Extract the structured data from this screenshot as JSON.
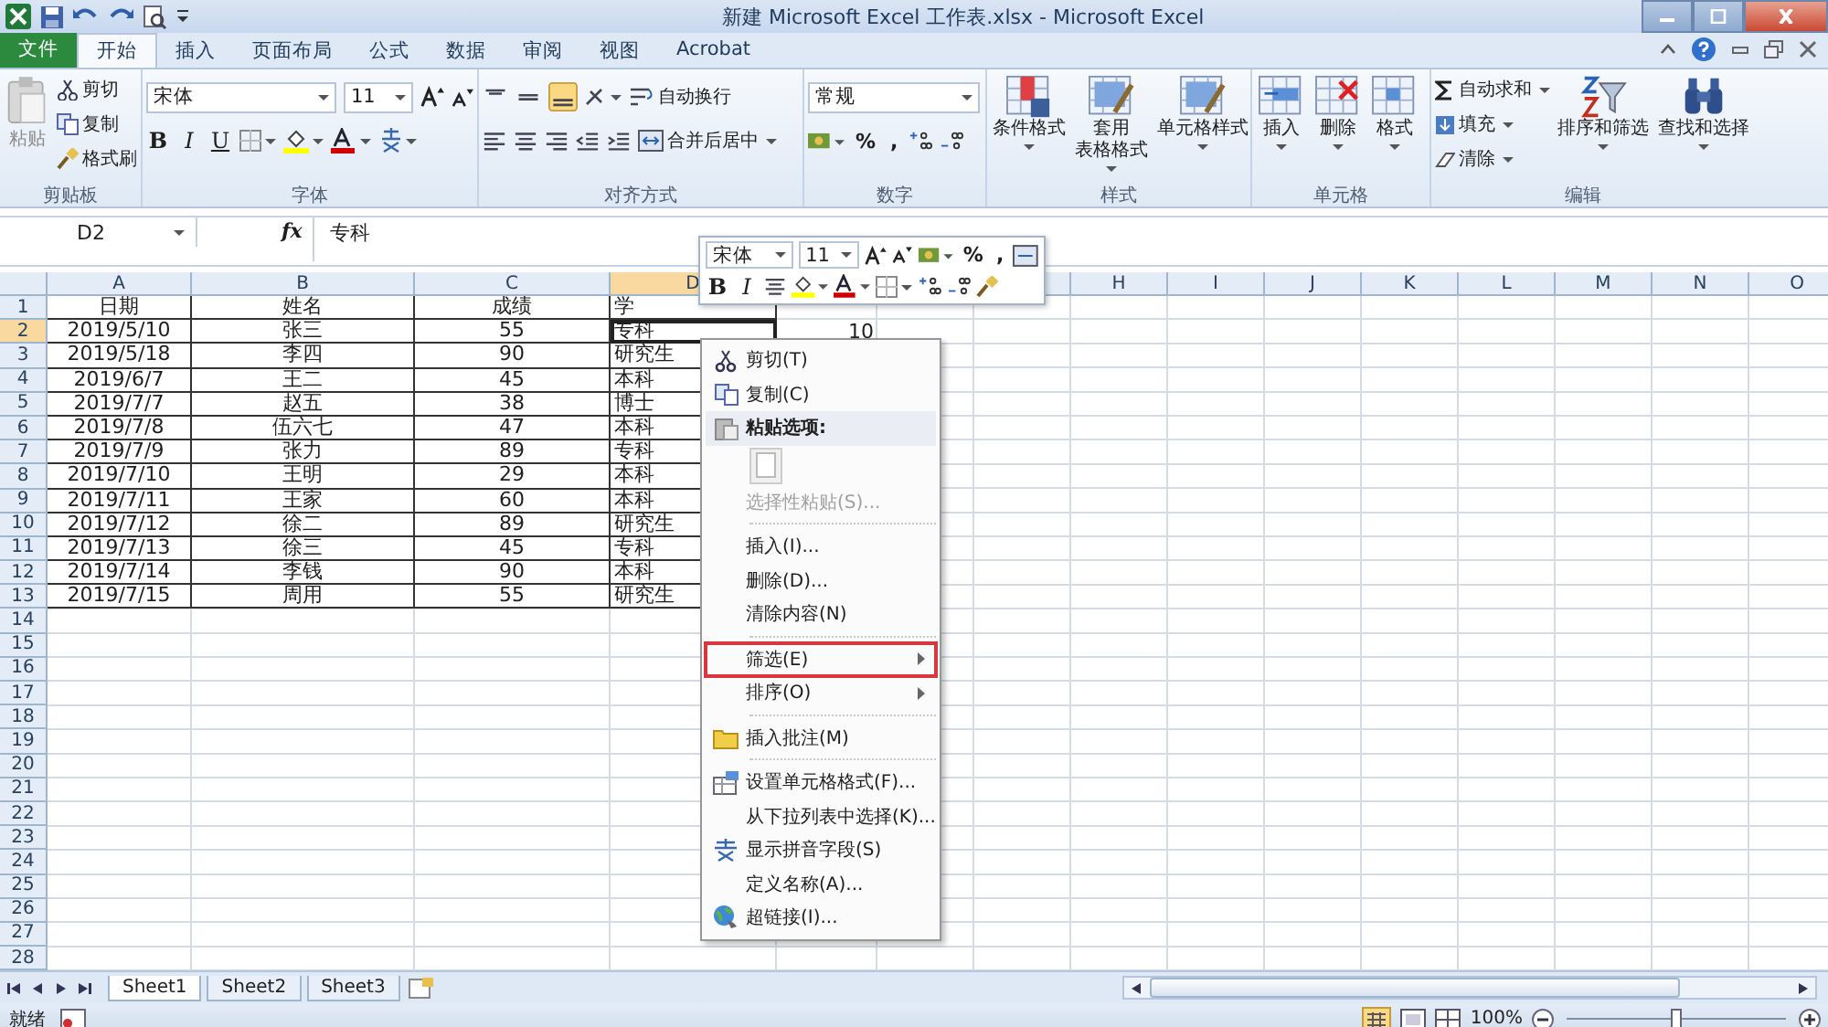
{
  "window": {
    "title": "新建 Microsoft Excel 工作表.xlsx - Microsoft Excel"
  },
  "tabs": [
    {
      "label": "文件",
      "kind": "file"
    },
    {
      "label": "开始",
      "kind": "tab",
      "selected": true
    },
    {
      "label": "插入",
      "kind": "tab",
      "selected": false
    },
    {
      "label": "页面布局",
      "kind": "tab",
      "selected": false
    },
    {
      "label": "公式",
      "kind": "tab",
      "selected": false
    },
    {
      "label": "数据",
      "kind": "tab",
      "selected": false
    },
    {
      "label": "审阅",
      "kind": "tab",
      "selected": false
    },
    {
      "label": "视图",
      "kind": "tab",
      "selected": false
    },
    {
      "label": "Acrobat",
      "kind": "tab",
      "selected": false
    }
  ],
  "ribbon": {
    "clipboard": {
      "label": "剪贴板",
      "paste": "粘贴",
      "items": [
        "剪切",
        "复制",
        "格式刷"
      ]
    },
    "font": {
      "label": "字体",
      "font": "宋体",
      "size": "11",
      "styles": [
        "B",
        "I",
        "U"
      ]
    },
    "alignment": {
      "label": "对齐方式",
      "wrap": "自动换行",
      "merge": "合并后居中"
    },
    "number": {
      "label": "数字",
      "format": "常规",
      "symbols": [
        "%",
        ","
      ]
    },
    "styles": {
      "label": "样式",
      "buttons": [
        {
          "lines": [
            "条件格式"
          ]
        },
        {
          "lines": [
            "套用",
            "表格格式"
          ]
        },
        {
          "lines": [
            "单元格样式"
          ]
        }
      ]
    },
    "cells": {
      "label": "单元格",
      "buttons": [
        {
          "lines": [
            "插入"
          ]
        },
        {
          "lines": [
            "删除"
          ]
        },
        {
          "lines": [
            "格式"
          ]
        }
      ]
    },
    "editing": {
      "label": "编辑",
      "items": [
        "自动求和",
        "填充",
        "清除"
      ],
      "buttons": [
        {
          "lines": [
            "排序和筛选"
          ]
        },
        {
          "lines": [
            "查找和选择"
          ]
        }
      ]
    }
  },
  "formula_bar": {
    "name_box": "D2",
    "fx": "fx",
    "value": "专科"
  },
  "columns": [
    {
      "label": "A",
      "selected": false
    },
    {
      "label": "B",
      "selected": false
    },
    {
      "label": "C",
      "selected": false
    },
    {
      "label": "D",
      "selected": true
    },
    {
      "selected": false
    },
    {
      "label": "H",
      "selected": false
    },
    {
      "label": "I",
      "selected": false
    },
    {
      "label": "J",
      "selected": false
    },
    {
      "label": "K",
      "selected": false
    },
    {
      "label": "L",
      "selected": false
    },
    {
      "label": "M",
      "selected": false
    },
    {
      "label": "N",
      "selected": false
    },
    {
      "label": "O",
      "selected": false
    }
  ],
  "rows": [
    {
      "number": "1",
      "selected": false,
      "cells": [
        "日期",
        "姓名",
        "成绩",
        "学"
      ]
    },
    {
      "number": "2",
      "selected": true,
      "cells": [
        "2019/5/10",
        "张三",
        "55",
        "专科",
        "10"
      ]
    },
    {
      "number": "3",
      "selected": false,
      "cells": [
        "2019/5/18",
        "李四",
        "90",
        "研究生"
      ]
    },
    {
      "number": "4",
      "selected": false,
      "cells": [
        "2019/6/7",
        "王二",
        "45",
        "本科"
      ]
    },
    {
      "number": "5",
      "selected": false,
      "cells": [
        "2019/7/7",
        "赵五",
        "38",
        "博士"
      ]
    },
    {
      "number": "6",
      "selected": false,
      "cells": [
        "2019/7/8",
        "伍六七",
        "47",
        "本科"
      ]
    },
    {
      "number": "7",
      "selected": false,
      "cells": [
        "2019/7/9",
        "张力",
        "89",
        "专科"
      ]
    },
    {
      "number": "8",
      "selected": false,
      "cells": [
        "2019/7/10",
        "王明",
        "29",
        "本科"
      ]
    },
    {
      "number": "9",
      "selected": false,
      "cells": [
        "2019/7/11",
        "王家",
        "60",
        "本科"
      ]
    },
    {
      "number": "10",
      "selected": false,
      "cells": [
        "2019/7/12",
        "徐二",
        "89",
        "研究生"
      ]
    },
    {
      "number": "11",
      "selected": false,
      "cells": [
        "2019/7/13",
        "徐三",
        "45",
        "专科"
      ]
    },
    {
      "number": "12",
      "selected": false,
      "cells": [
        "2019/7/14",
        "李钱",
        "90",
        "本科"
      ]
    },
    {
      "number": "13",
      "selected": false,
      "cells": [
        "2019/7/15",
        "周用",
        "55",
        "研究生"
      ]
    },
    {
      "number": "14",
      "selected": false
    },
    {
      "number": "15",
      "selected": false
    },
    {
      "number": "16",
      "selected": false
    },
    {
      "number": "17",
      "selected": false
    },
    {
      "number": "18",
      "selected": false
    },
    {
      "number": "19",
      "selected": false
    },
    {
      "number": "20",
      "selected": false
    },
    {
      "number": "21",
      "selected": false
    },
    {
      "number": "22",
      "selected": false
    },
    {
      "number": "23",
      "selected": false
    },
    {
      "number": "24",
      "selected": false
    },
    {
      "number": "25",
      "selected": false
    },
    {
      "number": "26",
      "selected": false
    },
    {
      "number": "27",
      "selected": false
    },
    {
      "number": "28",
      "selected": false
    }
  ],
  "mini_toolbar": {
    "font": "宋体",
    "size": "11",
    "styles": [
      "B",
      "I"
    ],
    "symbols": [
      "%",
      ","
    ]
  },
  "context_menu": [
    {
      "kind": "item",
      "label": "剪切(T)",
      "disabled": false,
      "submenu": false,
      "outlined": false
    },
    {
      "kind": "item",
      "label": "复制(C)",
      "disabled": false,
      "submenu": false,
      "outlined": false
    },
    {
      "kind": "header",
      "label": "粘贴选项:"
    },
    {
      "kind": "paste"
    },
    {
      "kind": "item",
      "label": "选择性粘贴(S)...",
      "disabled": true,
      "submenu": false,
      "outlined": false
    },
    {
      "kind": "separator"
    },
    {
      "kind": "item",
      "label": "插入(I)...",
      "disabled": false,
      "submenu": false,
      "outlined": false
    },
    {
      "kind": "item",
      "label": "删除(D)...",
      "disabled": false,
      "submenu": false,
      "outlined": false
    },
    {
      "kind": "item",
      "label": "清除内容(N)",
      "disabled": false,
      "submenu": false,
      "outlined": false
    },
    {
      "kind": "separator"
    },
    {
      "kind": "item",
      "label": "筛选(E)",
      "disabled": false,
      "submenu": true,
      "outlined": true
    },
    {
      "kind": "item",
      "label": "排序(O)",
      "disabled": false,
      "submenu": true,
      "outlined": false
    },
    {
      "kind": "separator"
    },
    {
      "kind": "item",
      "label": "插入批注(M)",
      "disabled": false,
      "submenu": false,
      "outlined": false
    },
    {
      "kind": "separator"
    },
    {
      "kind": "item",
      "label": "设置单元格格式(F)...",
      "disabled": false,
      "submenu": false,
      "outlined": false
    },
    {
      "kind": "item",
      "label": "从下拉列表中选择(K)...",
      "disabled": false,
      "submenu": false,
      "outlined": false
    },
    {
      "kind": "item",
      "label": "显示拼音字段(S)",
      "disabled": false,
      "submenu": false,
      "outlined": false
    },
    {
      "kind": "item",
      "label": "定义名称(A)...",
      "disabled": false,
      "submenu": false,
      "outlined": false
    },
    {
      "kind": "item",
      "label": "超链接(I)...",
      "disabled": false,
      "submenu": false,
      "outlined": false
    }
  ],
  "sheets": [
    {
      "label": "Sheet1",
      "selected": true
    },
    {
      "label": "Sheet2",
      "selected": false
    },
    {
      "label": "Sheet3",
      "selected": false
    }
  ],
  "status_bar": {
    "status": "就绪",
    "zoom": "100%",
    "zoom_slider": {
      "level": 0.5
    }
  }
}
